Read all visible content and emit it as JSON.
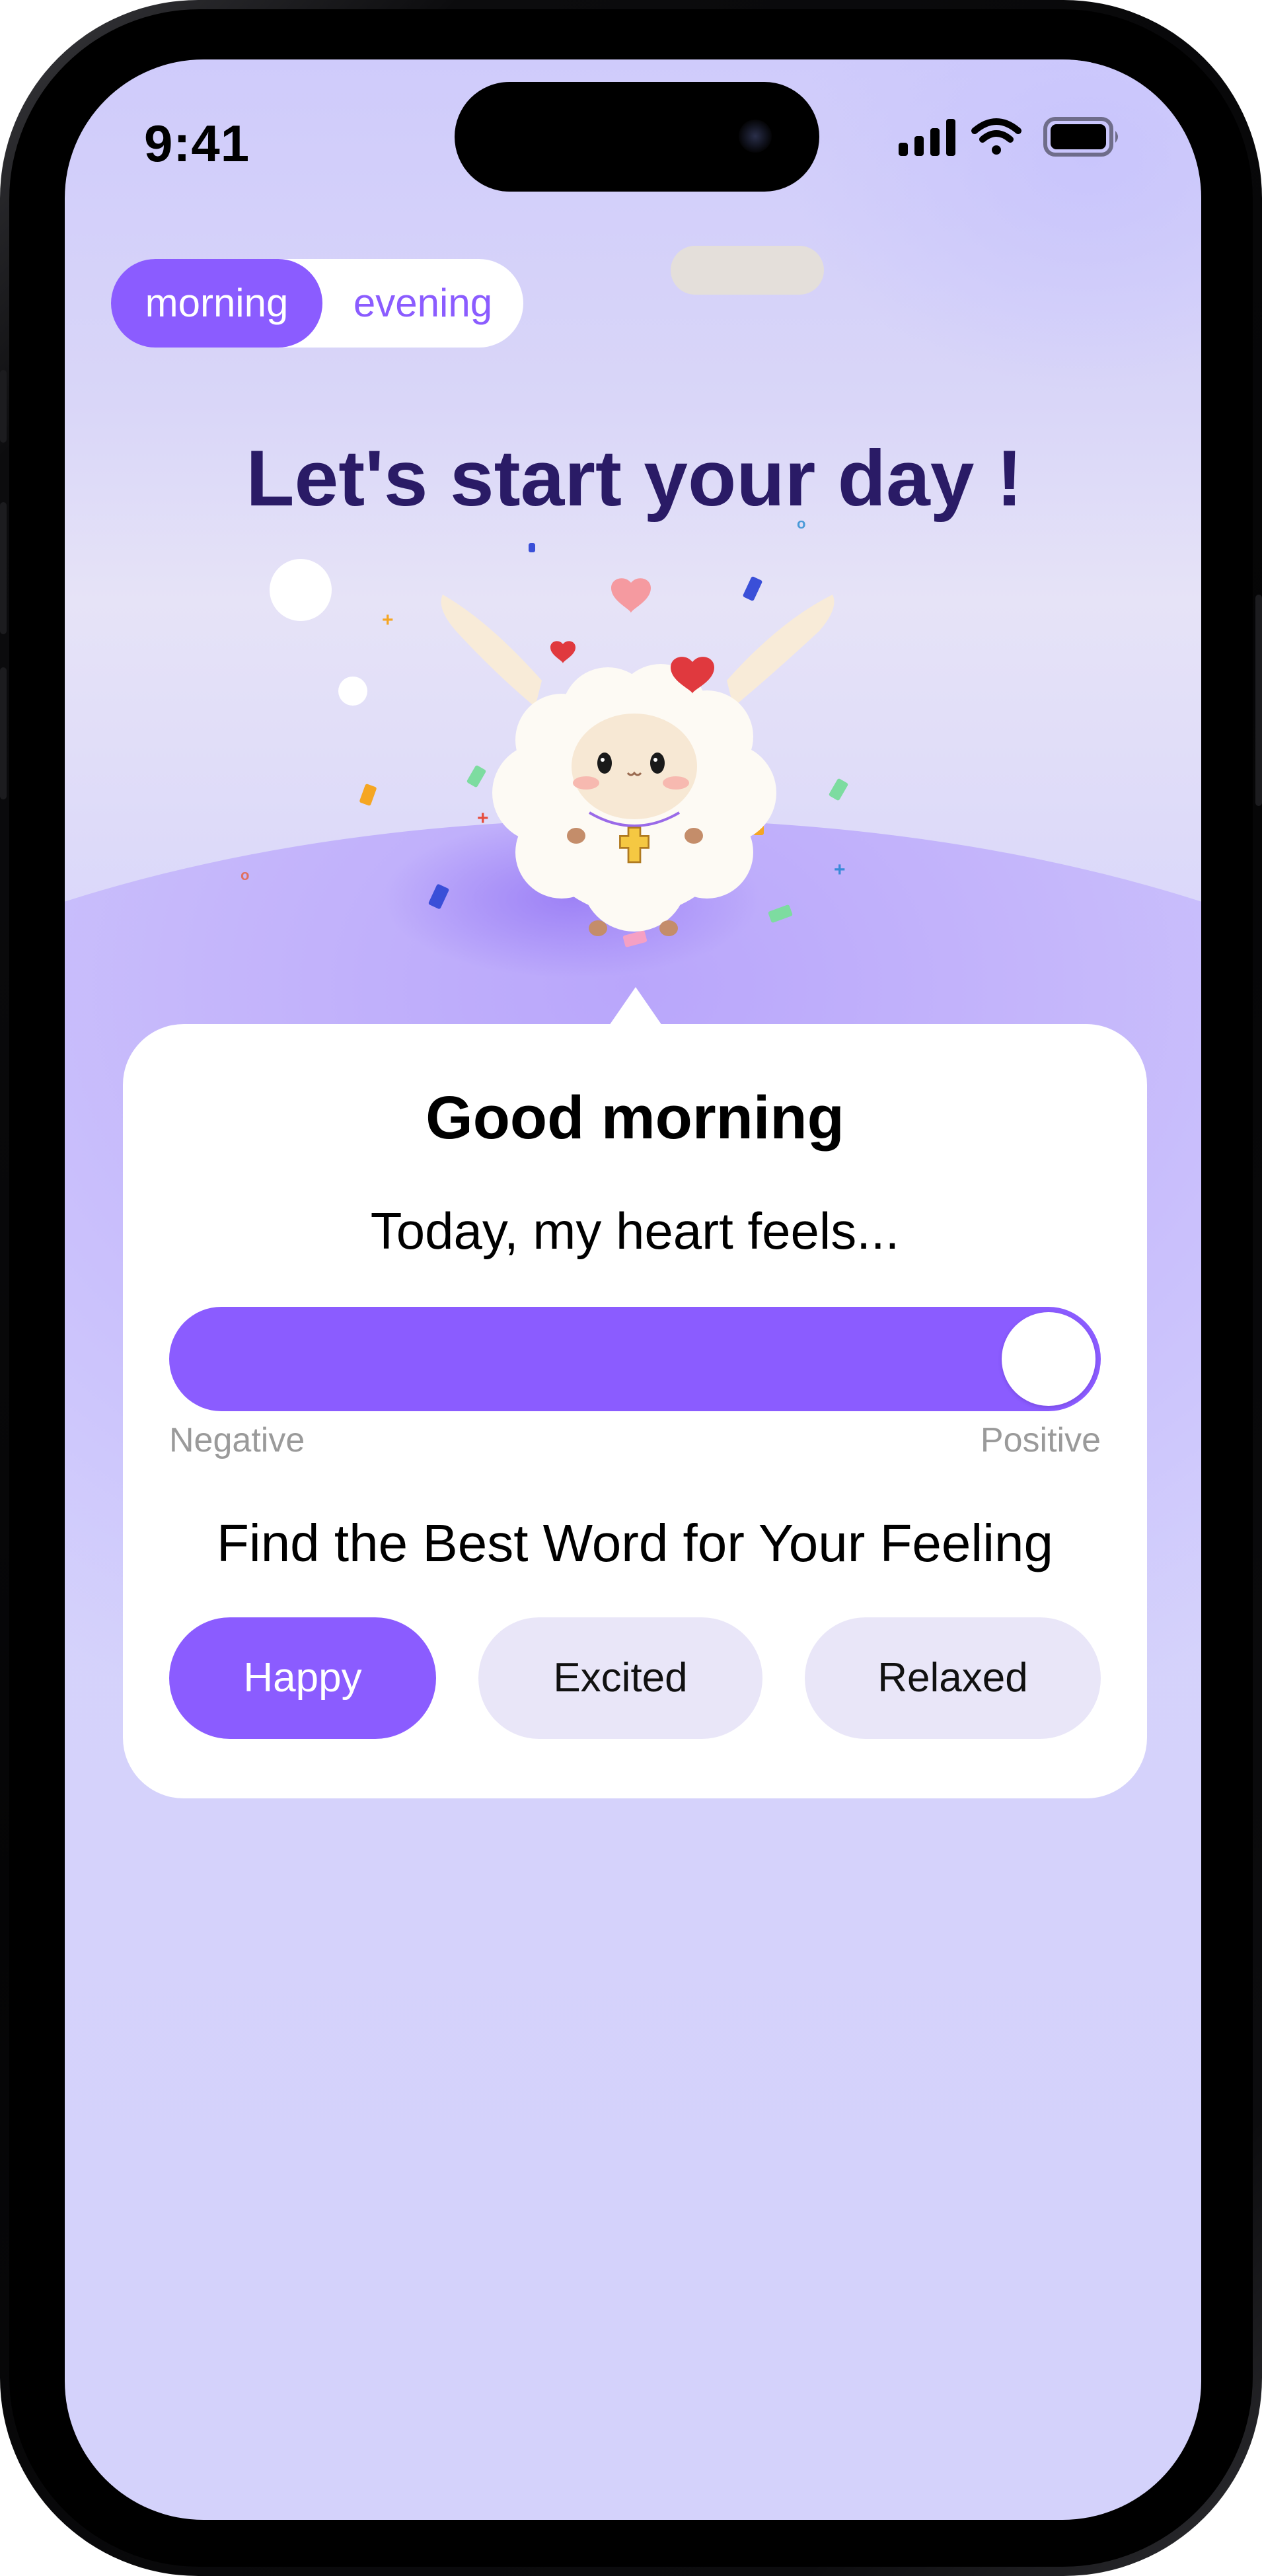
{
  "status_bar": {
    "time": "9:41",
    "icons": [
      "cellular-signal-icon",
      "wifi-icon",
      "battery-icon"
    ]
  },
  "mode_toggle": {
    "options": [
      "morning",
      "evening"
    ],
    "selected": "morning"
  },
  "headline": "Let's start your day !",
  "card": {
    "greeting": "Good morning",
    "question": "Today, my heart feels...",
    "mood_slider": {
      "min_label": "Negative",
      "max_label": "Positive",
      "value": 1.0
    },
    "word_prompt": "Find the Best Word for Your Feeling",
    "words": [
      "Happy",
      "Excited",
      "Relaxed"
    ],
    "selected_word": "Happy"
  },
  "colors": {
    "accent": "#8b5cff",
    "headline": "#2a1b66",
    "background": "#d4d2fb",
    "chip_inactive": "#e9e6f8",
    "scale_label": "#9a9a9a"
  }
}
